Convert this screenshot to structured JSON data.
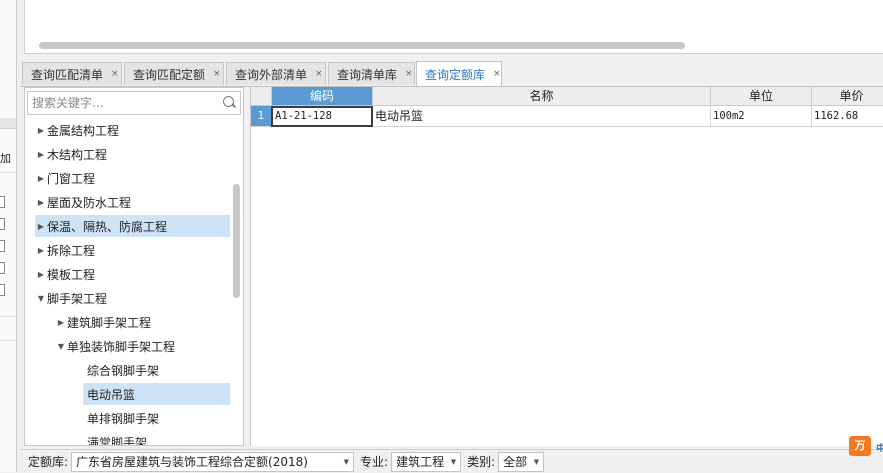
{
  "tabs": [
    {
      "label": "查询匹配清单",
      "active": false
    },
    {
      "label": "查询匹配定额",
      "active": false
    },
    {
      "label": "查询外部清单",
      "active": false
    },
    {
      "label": "查询清单库",
      "active": false
    },
    {
      "label": "查询定额库",
      "active": true
    }
  ],
  "tab_close_glyph": "×",
  "left_strip_label": "加",
  "search": {
    "placeholder": "搜索关键字...",
    "value": ""
  },
  "tree": [
    {
      "label": "金属结构工程",
      "expanded": false,
      "selected": false
    },
    {
      "label": "木结构工程",
      "expanded": false,
      "selected": false
    },
    {
      "label": "门窗工程",
      "expanded": false,
      "selected": false
    },
    {
      "label": "屋面及防水工程",
      "expanded": false,
      "selected": false
    },
    {
      "label": "保温、隔热、防腐工程",
      "expanded": false,
      "selected": false
    },
    {
      "label": "拆除工程",
      "expanded": false,
      "selected": false
    },
    {
      "label": "模板工程",
      "expanded": false,
      "selected": false
    },
    {
      "label": "脚手架工程",
      "expanded": true,
      "selected": false
    },
    {
      "label": "建筑脚手架工程",
      "expanded": false,
      "selected": false
    },
    {
      "label": "单独装饰脚手架工程",
      "expanded": true,
      "selected": false
    },
    {
      "label": "综合钢脚手架",
      "selected": false
    },
    {
      "label": "电动吊篮",
      "selected": true
    },
    {
      "label": "单排钢脚手架",
      "selected": false
    },
    {
      "label": "满堂脚手架",
      "selected": false
    }
  ],
  "grid": {
    "columns": [
      "编码",
      "名称",
      "单位",
      "单价"
    ],
    "rows": [
      {
        "num": "1",
        "code": "A1-21-128",
        "name": "电动吊篮",
        "unit": "100m2",
        "price": "1162.68"
      }
    ]
  },
  "bottom": {
    "quota_label": "定额库:",
    "quota_value": "广东省房屋建筑与装饰工程综合定额(2018)",
    "major_label": "专业:",
    "major_value": "建筑工程",
    "category_label": "类别:",
    "category_value": "全部"
  },
  "logo_text": "万",
  "logo2_text": "中"
}
